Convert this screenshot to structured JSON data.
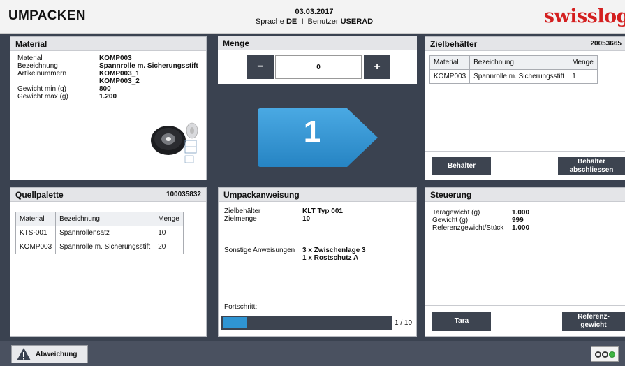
{
  "header": {
    "title": "UMPACKEN",
    "date": "03.03.2017",
    "language_label": "Sprache",
    "language": "DE",
    "separator": "I",
    "user_label": "Benutzer",
    "user": "USERAD",
    "logo_text": "swisslog"
  },
  "material": {
    "title": "Material",
    "fields": [
      {
        "label": "Material",
        "value": "KOMP003"
      },
      {
        "label": "Bezeichnung",
        "value": "Spannrolle m. Sicherungsstift"
      },
      {
        "label": "Artikelnummern",
        "value": "KOMP003_1"
      },
      {
        "label": "",
        "value": "KOMP003_2"
      },
      {
        "label": "Gewicht min (g)",
        "value": "800"
      },
      {
        "label": "Gewicht max (g)",
        "value": "1.200"
      }
    ]
  },
  "menge": {
    "title": "Menge",
    "minus": "−",
    "plus": "+",
    "value": "0",
    "big_count": "1"
  },
  "zielbehaelter": {
    "title": "Zielbehälter",
    "number": "20053665",
    "columns": [
      "Material",
      "Bezeichnung",
      "Menge"
    ],
    "rows": [
      [
        "KOMP003",
        "Spannrolle m. Sicherungsstift",
        "1"
      ]
    ],
    "btn_behaelter": "Behälter",
    "btn_close_line1": "Behälter",
    "btn_close_line2": "abschliessen"
  },
  "quellpalette": {
    "title": "Quellpalette",
    "number": "100035832",
    "columns": [
      "Material",
      "Bezeichnung",
      "Menge"
    ],
    "rows": [
      [
        "KTS-001",
        "Spannrollensatz",
        "10"
      ],
      [
        "KOMP003",
        "Spannrolle m. Sicherungsstift",
        "20"
      ]
    ]
  },
  "umpackanweisung": {
    "title": "Umpackanweisung",
    "ziel_label": "Zielbehälter",
    "ziel_value": "KLT Typ 001",
    "zielmenge_label": "Zielmenge",
    "zielmenge_value": "10",
    "sonstige_label": "Sonstige Anweisungen",
    "sonstige_line1": "3 x Zwischenlage 3",
    "sonstige_line2": "1 x Rostschutz A",
    "progress_label": "Fortschritt:",
    "progress_text": "1 / 10",
    "progress_fraction": 0.1
  },
  "steuerung": {
    "title": "Steuerung",
    "fields": [
      {
        "label": "Taragewicht (g)",
        "value": "1.000"
      },
      {
        "label": "Gewicht (g)",
        "value": "999"
      },
      {
        "label": "Referenzgewicht/Stück",
        "value": "1.000"
      }
    ],
    "btn_tara": "Tara",
    "btn_ref_line1": "Referenz-",
    "btn_ref_line2": "gewicht"
  },
  "footer": {
    "abweichung": "Abweichung"
  },
  "colors": {
    "accent_blue": "#2f95d3",
    "dark": "#3a4250",
    "logo_red": "#d41f1f",
    "status_green": "#3fb542"
  }
}
